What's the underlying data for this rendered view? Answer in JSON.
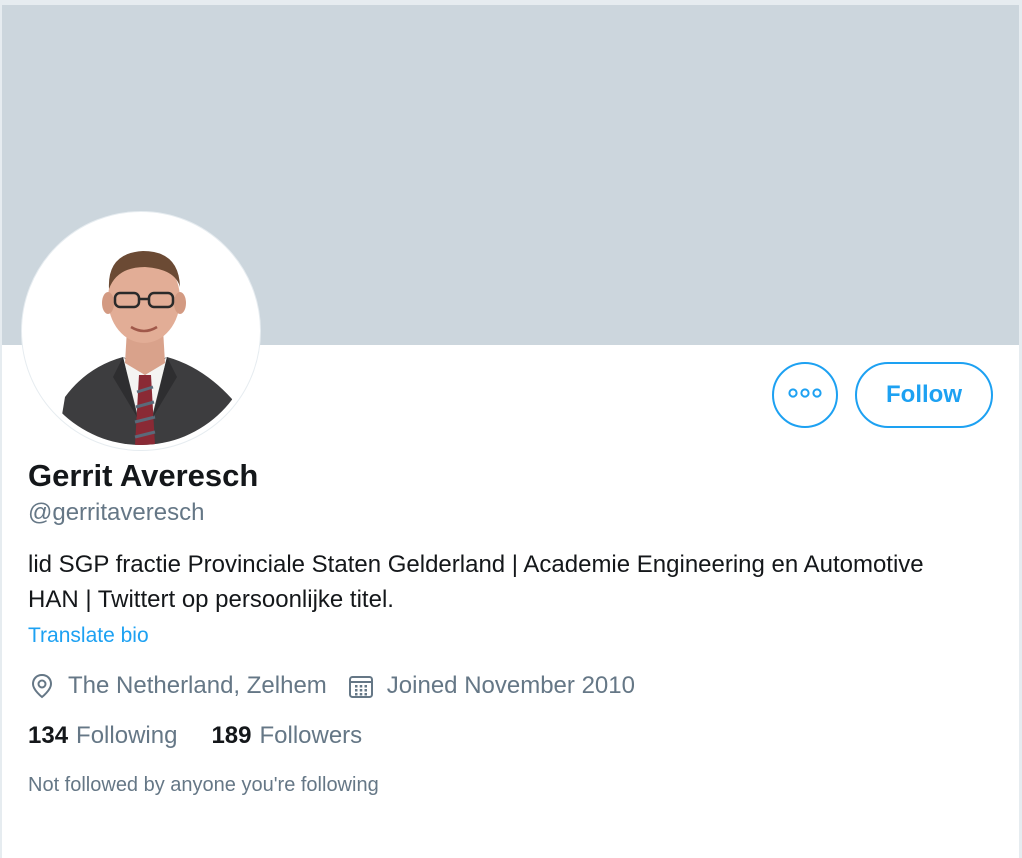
{
  "profile": {
    "name": "Gerrit Averesch",
    "handle": "@gerritaveresch",
    "bio": "lid SGP fractie Provinciale Staten Gelderland | Academie Engineering en Automotive HAN | Twittert op persoonlijke titel.",
    "translate_label": "Translate bio",
    "location": "The Netherland, Zelhem",
    "joined": "Joined November 2010",
    "following_count": "134",
    "following_label": "Following",
    "followers_count": "189",
    "followers_label": "Followers",
    "mutual_note": "Not followed by anyone you're following"
  },
  "actions": {
    "follow_label": "Follow",
    "more_icon": "more-horizontal-icon"
  },
  "icons": {
    "location": "location-pin-icon",
    "calendar": "calendar-icon"
  },
  "colors": {
    "accent": "#1da1f2",
    "banner": "#ccd6dd",
    "secondary_text": "#657786",
    "primary_text": "#14171a"
  }
}
